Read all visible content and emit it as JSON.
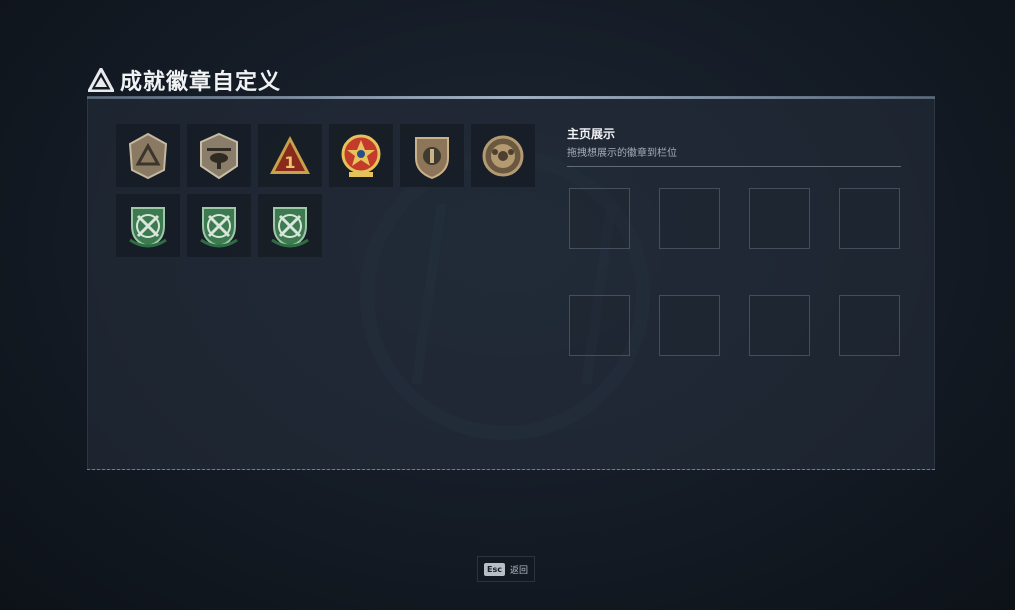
{
  "header": {
    "title": "成就徽章自定义",
    "icon": "triangle-emblem-icon"
  },
  "badges": [
    {
      "icon": "pentagon-triangle-badge-icon",
      "colors": {
        "base": "#8a7a63",
        "accent": "#5a4d3c"
      }
    },
    {
      "icon": "helicopter-shield-badge-icon",
      "colors": {
        "base": "#8a7e6a",
        "accent": "#4d4539"
      }
    },
    {
      "icon": "triangle-number-one-badge-icon",
      "colors": {
        "base": "#c7a24a",
        "accent": "#8a2a1c"
      }
    },
    {
      "icon": "star-medal-badge-icon",
      "colors": {
        "base": "#c43a2b",
        "accent": "#e6c25a"
      }
    },
    {
      "icon": "shield-emblem-badge-icon",
      "colors": {
        "base": "#8c7558",
        "accent": "#3f3a2e"
      }
    },
    {
      "icon": "round-crest-badge-icon",
      "colors": {
        "base": "#b39a70",
        "accent": "#6a5940"
      }
    },
    {
      "icon": "green-crossed-swords-badge-icon",
      "colors": {
        "base": "#3d7a4f",
        "accent": "#d9e6dc"
      }
    },
    {
      "icon": "green-crossed-swords-badge-icon",
      "colors": {
        "base": "#3d7a4f",
        "accent": "#d9e6dc"
      }
    },
    {
      "icon": "green-crossed-swords-badge-icon",
      "colors": {
        "base": "#3d7a4f",
        "accent": "#d9e6dc"
      }
    }
  ],
  "showcase": {
    "title": "主页展示",
    "hint": "拖拽想展示的徽章到栏位",
    "slot_count": 8
  },
  "footer": {
    "key_label": "Esc",
    "action_label": "返回"
  }
}
